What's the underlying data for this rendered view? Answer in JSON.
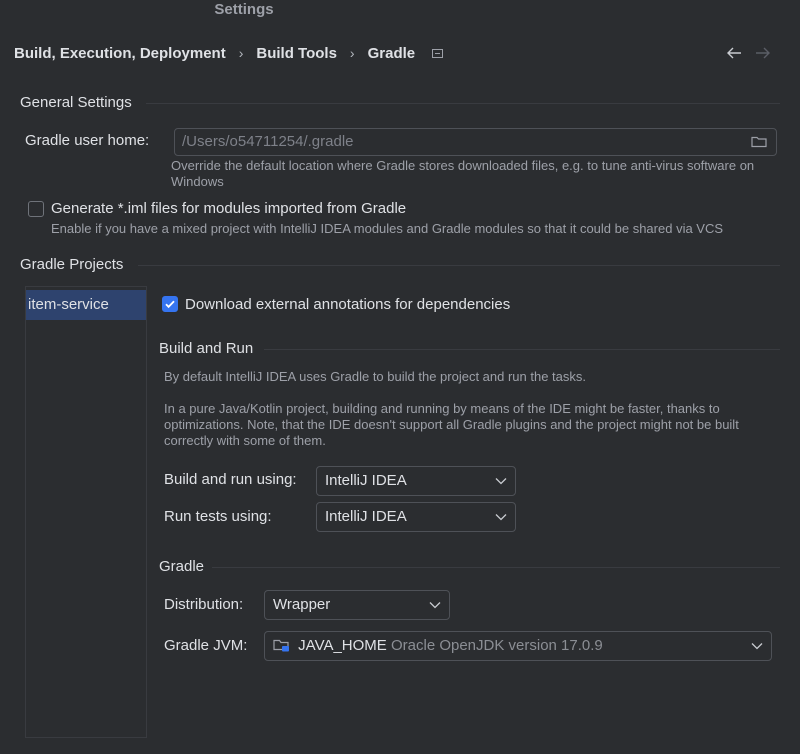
{
  "window": {
    "title": "Settings"
  },
  "breadcrumb": {
    "items": [
      "Build, Execution, Deployment",
      "Build Tools",
      "Gradle"
    ],
    "separator": "›"
  },
  "nav": {
    "back_icon": "arrow-left-icon",
    "forward_icon": "arrow-right-icon"
  },
  "general": {
    "title": "General Settings",
    "gradle_user_home_label": "Gradle user home:",
    "gradle_user_home_value": "/Users/o54711254/.gradle",
    "gradle_user_home_hint_line1": "Override the default location where Gradle stores downloaded files, e.g. to tune anti-virus software on",
    "gradle_user_home_hint_line2": "Windows",
    "generate_iml_label": "Generate *.iml files for modules imported from Gradle",
    "generate_iml_checked": false,
    "generate_iml_hint": "Enable if you have a mixed project with IntelliJ IDEA modules and Gradle modules so that it could be shared via VCS"
  },
  "projects": {
    "title": "Gradle Projects",
    "list": [
      "item-service"
    ],
    "download_annotations_label": "Download external annotations for dependencies",
    "download_annotations_checked": true
  },
  "build_and_run": {
    "title": "Build and Run",
    "desc1": "By default IntelliJ IDEA uses Gradle to build the project and run the tasks.",
    "desc2_line1": "In a pure Java/Kotlin project, building and running by means of the IDE might be faster, thanks to",
    "desc2_line2": "optimizations. Note, that the IDE doesn't support all Gradle plugins and the project might not be built",
    "desc2_line3": "correctly with some of them.",
    "build_run_label": "Build and run using:",
    "build_run_value": "IntelliJ IDEA",
    "run_tests_label": "Run tests using:",
    "run_tests_value": "IntelliJ IDEA"
  },
  "gradle": {
    "title": "Gradle",
    "distribution_label": "Distribution:",
    "distribution_value": "Wrapper",
    "jvm_label": "Gradle JVM:",
    "jvm_value": "JAVA_HOME",
    "jvm_detail": "Oracle OpenJDK version 17.0.9"
  },
  "colors": {
    "background": "#2b2d30",
    "accent": "#3574f0",
    "selection": "#2e436e",
    "text": "#dfe1e5",
    "hint": "#9da0a8"
  }
}
